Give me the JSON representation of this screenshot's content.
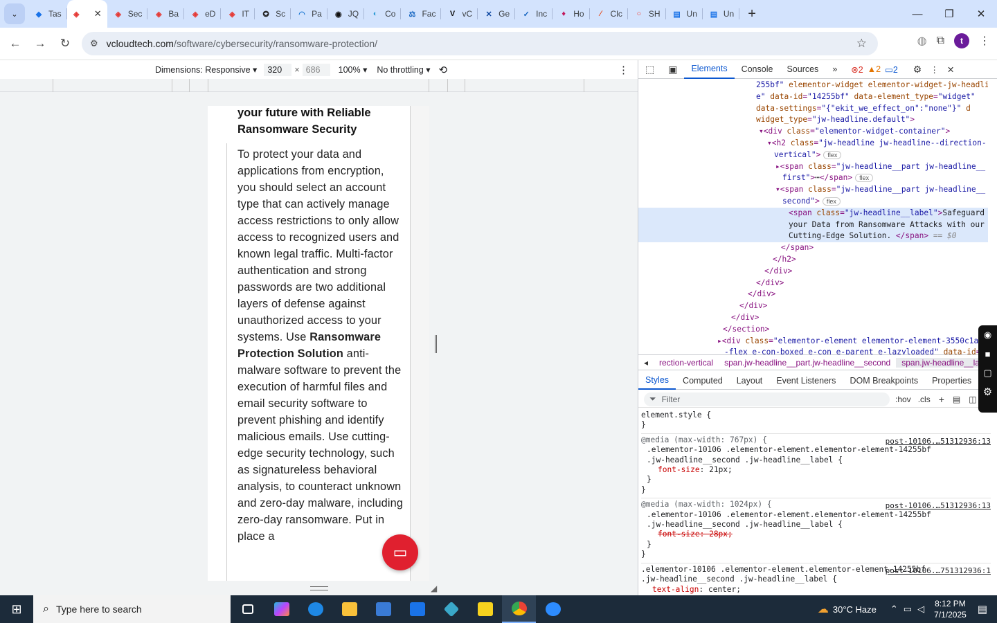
{
  "browser": {
    "tabs": [
      {
        "label": "Tas",
        "color": "#1a73e8",
        "glyph": "◆"
      },
      {
        "label": "",
        "color": "#e53935",
        "glyph": "◈",
        "active": true
      },
      {
        "label": "Sec",
        "color": "#e53935",
        "glyph": "◈"
      },
      {
        "label": "Ba",
        "color": "#e53935",
        "glyph": "◈"
      },
      {
        "label": "eD",
        "color": "#e53935",
        "glyph": "◈"
      },
      {
        "label": "IT",
        "color": "#e53935",
        "glyph": "◈"
      },
      {
        "label": "Sc",
        "color": "#222",
        "glyph": "✪"
      },
      {
        "label": "Pa",
        "color": "#1976d2",
        "glyph": "◠"
      },
      {
        "label": "JQ",
        "color": "#111",
        "glyph": "◉"
      },
      {
        "label": "Co",
        "color": "#2e9bd6",
        "glyph": "◐"
      },
      {
        "label": "Fac",
        "color": "#1565c0",
        "glyph": "⚖"
      },
      {
        "label": "vC",
        "color": "#111",
        "glyph": "V"
      },
      {
        "label": "Ge",
        "color": "#0d47a1",
        "glyph": "✕"
      },
      {
        "label": "Inc",
        "color": "#1565c0",
        "glyph": "✓"
      },
      {
        "label": "Ho",
        "color": "#c2185b",
        "glyph": "♦"
      },
      {
        "label": "Clc",
        "color": "#e64a19",
        "glyph": "∕"
      },
      {
        "label": "SH",
        "color": "#f44336",
        "glyph": "○"
      },
      {
        "label": "Un",
        "color": "#1a73e8",
        "glyph": "▤"
      },
      {
        "label": "Un",
        "color": "#1a73e8",
        "glyph": "▤"
      }
    ],
    "url_domain": "vcloudtech.com",
    "url_path": "/software/cybersecurity/ransomware-protection/",
    "profile_initial": "t"
  },
  "device_toolbar": {
    "dimensions_label": "Dimensions: Responsive",
    "width": "320",
    "height": "686",
    "zoom": "100%",
    "throttling": "No throttling"
  },
  "page": {
    "heading": "your future with Reliable Ransomware Security",
    "para_1": "To protect your data and applications from encryption, you should select an account type that can actively manage access restrictions to only allow access to recognized users and known legal traffic. Multi-factor authentication and strong passwords are two additional layers of defense against unauthorized access to your systems. Use ",
    "para_bold": "Ransomware Protection Solution",
    "para_2": " anti-malware software to prevent the execution of harmful files and email security software to prevent phishing and identify malicious emails.  Use cutting-edge security technology, such as signatureless behavioral analysis, to counteract unknown and zero-day malware, including zero-day ransomware. Put in place a"
  },
  "devtools": {
    "tabs": [
      "Elements",
      "Console",
      "Sources"
    ],
    "errors": "2",
    "warnings": "2",
    "infos": "2",
    "breadcrumbs": [
      "rection-vertical",
      "span.jw-headline__part.jw-headline__second",
      "span.jw-headline__label"
    ],
    "subtabs": [
      "Styles",
      "Computed",
      "Layout",
      "Event Listeners",
      "DOM Breakpoints",
      "Properties"
    ],
    "filter_placeholder": "Filter",
    "hov": ":hov",
    "cls": ".cls",
    "styles": {
      "element_style": "element.style {",
      "rule1_media": "@media (max-width: 767px) {",
      "rule1_src": "post-10106.…51312936:13",
      "rule1_sel": ".elementor-10106 .elementor-element.elementor-element-14255bf .jw-headline__second .jw-headline__label {",
      "rule1_prop": "font-size",
      "rule1_val": "21px;",
      "rule2_media": "@media (max-width: 1024px) {",
      "rule2_src": "post-10106.…51312936:13",
      "rule2_sel": ".elementor-10106 .elementor-element.elementor-element-14255bf .jw-headline__second .jw-headline__label {",
      "rule2_prop": "font-size: 28px;",
      "rule3_sel": ".elementor-10106 .elementor-element.elementor-element-14255bf .jw-headline__second .jw-headline__label {",
      "rule3_src": "post-10106.…751312936:1",
      "rule3_prop": "text-align",
      "rule3_val": "center;"
    }
  },
  "taskbar": {
    "search_placeholder": "Type here to search",
    "weather": "30°C  Haze",
    "time": "8:12 PM",
    "date": "7/1/2025"
  }
}
